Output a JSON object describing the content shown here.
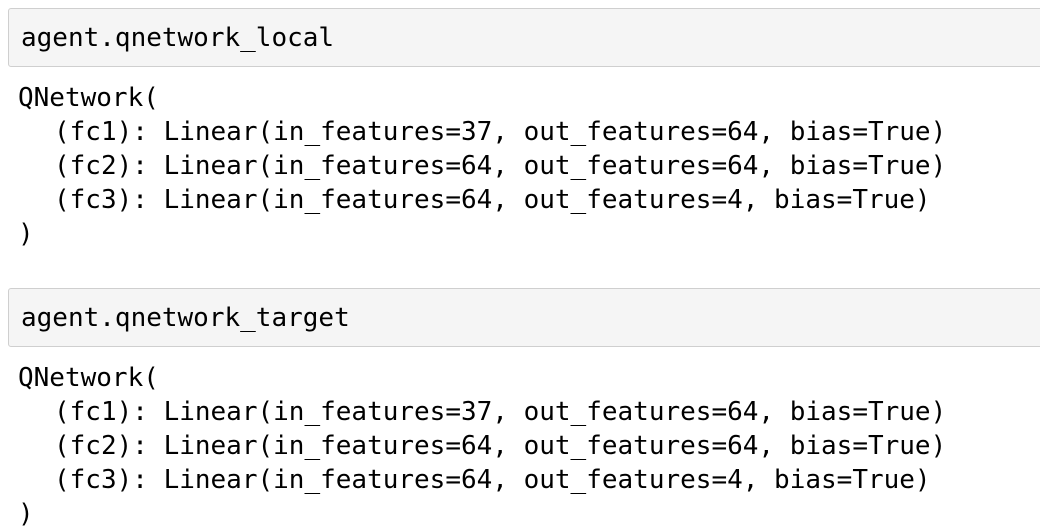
{
  "cells": [
    {
      "input": "agent.qnetwork_local",
      "output": {
        "open": "QNetwork(",
        "layers": [
          "(fc1): Linear(in_features=37, out_features=64, bias=True)",
          "(fc2): Linear(in_features=64, out_features=64, bias=True)",
          "(fc3): Linear(in_features=64, out_features=4, bias=True)"
        ],
        "close": ")"
      }
    },
    {
      "input": "agent.qnetwork_target",
      "output": {
        "open": "QNetwork(",
        "layers": [
          "(fc1): Linear(in_features=37, out_features=64, bias=True)",
          "(fc2): Linear(in_features=64, out_features=64, bias=True)",
          "(fc3): Linear(in_features=64, out_features=4, bias=True)"
        ],
        "close": ")"
      }
    }
  ]
}
